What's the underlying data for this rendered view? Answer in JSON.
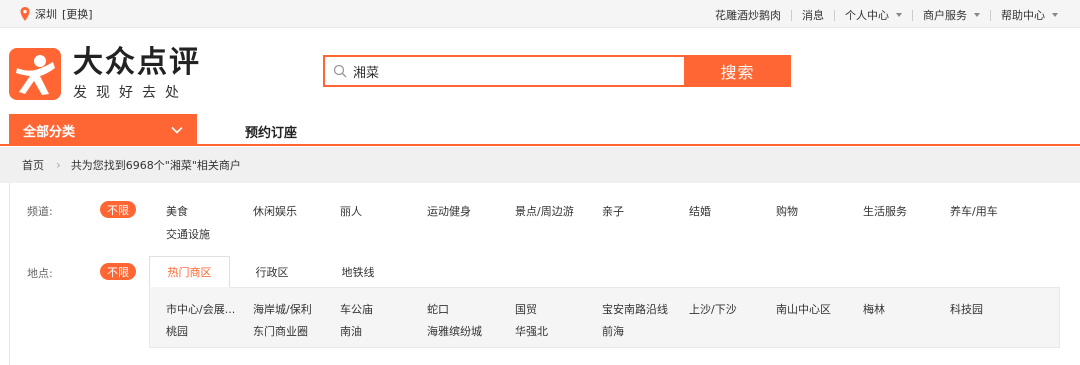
{
  "topbar": {
    "city": "深圳",
    "change_city": "[更换]",
    "links": [
      "花雕酒炒鹅肉",
      "消息",
      "个人中心",
      "商户服务",
      "帮助中心"
    ]
  },
  "logo": {
    "title": "大众点评",
    "slogan": "发现好去处"
  },
  "search": {
    "value": "湘菜",
    "button": "搜索"
  },
  "nav": {
    "all_categories": "全部分类",
    "reserve": "预约订座"
  },
  "breadcrumb": {
    "home": "首页",
    "result": "共为您找到6968个\"湘菜\"相关商户"
  },
  "filter": {
    "channel_label": "频道:",
    "unlimited": "不限",
    "channels": [
      "美食",
      "休闲娱乐",
      "丽人",
      "运动健身",
      "景点/周边游",
      "亲子",
      "结婚",
      "购物",
      "生活服务",
      "养车/用车",
      "交通设施"
    ],
    "location_label": "地点:",
    "tabs": [
      "热门商区",
      "行政区",
      "地铁线"
    ],
    "areas": [
      "市中心/会展...",
      "海岸城/保利",
      "车公庙",
      "蛇口",
      "国贸",
      "宝安南路沿线",
      "上沙/下沙",
      "南山中心区",
      "梅林",
      "科技园",
      "桃园",
      "东门商业圈",
      "南油",
      "海雅缤纷城",
      "华强北",
      "前海"
    ]
  },
  "colors": {
    "accent": "#ff6633"
  }
}
